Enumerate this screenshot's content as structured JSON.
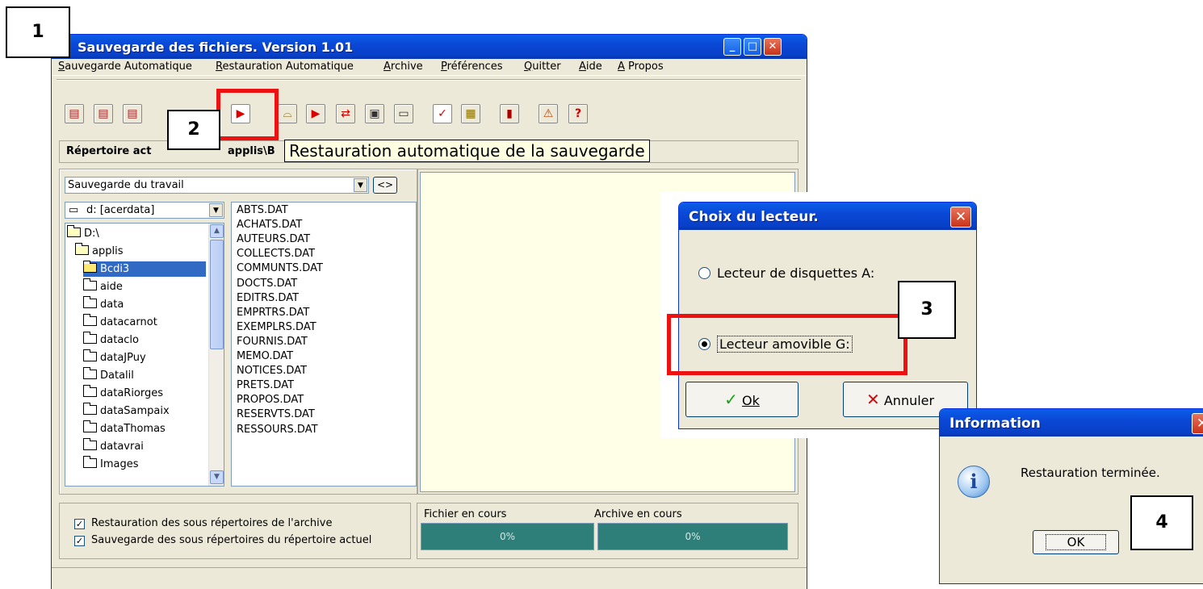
{
  "main_window": {
    "title": "Sauvegarde des fichiers. Version 1.01",
    "title_buttons": {
      "minimize": "_",
      "maximize": "□",
      "close": "✕"
    },
    "menu": [
      "Sauvegarde Automatique",
      "Restauration Automatique",
      "Archive",
      "Préférences",
      "Quitter",
      "Aide",
      "A Propos"
    ],
    "toolbar_icons": [
      "save-all-icon",
      "save-icon",
      "save-alt-icon",
      "restore-auto-icon",
      "open-folder-icon",
      "restore-icon",
      "transfer-icon",
      "copy-icon",
      "folder-icon",
      "check-icon",
      "archive-icon",
      "exit-door-icon",
      "help-book-icon",
      "question-icon"
    ],
    "path_label": "Répertoire act",
    "path_value": "applis\\B",
    "tooltip": "Restauration automatique de la sauvegarde",
    "profile_combo": "Sauvegarde du travail",
    "swap_button": "<>",
    "drive_combo": "d: [acerdata]",
    "tree": [
      {
        "label": "D:\\",
        "indent": 0,
        "open": true
      },
      {
        "label": "applis",
        "indent": 1,
        "open": true
      },
      {
        "label": "Bcdi3",
        "indent": 2,
        "open": true,
        "selected": true
      },
      {
        "label": "aide",
        "indent": 2
      },
      {
        "label": "data",
        "indent": 2
      },
      {
        "label": "datacarnot",
        "indent": 2
      },
      {
        "label": "dataclo",
        "indent": 2
      },
      {
        "label": "dataJPuy",
        "indent": 2
      },
      {
        "label": "Datalil",
        "indent": 2
      },
      {
        "label": "dataRiorges",
        "indent": 2
      },
      {
        "label": "dataSampaix",
        "indent": 2
      },
      {
        "label": "dataThomas",
        "indent": 2
      },
      {
        "label": "datavrai",
        "indent": 2
      },
      {
        "label": "Images",
        "indent": 2
      }
    ],
    "files": [
      "ABTS.DAT",
      "ACHATS.DAT",
      "AUTEURS.DAT",
      "COLLECTS.DAT",
      "COMMUNTS.DAT",
      "DOCTS.DAT",
      "EDITRS.DAT",
      "EMPRTRS.DAT",
      "EXEMPLRS.DAT",
      "FOURNIS.DAT",
      "MEMO.DAT",
      "NOTICES.DAT",
      "PRETS.DAT",
      "PROPOS.DAT",
      "RESERVTS.DAT",
      "RESSOURS.DAT"
    ],
    "options": [
      {
        "label": "Restauration des sous répertoires de l'archive",
        "checked": true
      },
      {
        "label": "Sauvegarde des sous répertoires du répertoire actuel",
        "checked": true
      }
    ],
    "progress": {
      "file_label": "Fichier en cours",
      "file_value": "0%",
      "archive_label": "Archive en cours",
      "archive_value": "0%"
    }
  },
  "drive_dialog": {
    "title": "Choix du lecteur.",
    "options": [
      {
        "label": "Lecteur de disquettes A:",
        "selected": false
      },
      {
        "label": "Lecteur amovible G:",
        "selected": true
      }
    ],
    "ok_label": "Ok",
    "cancel_label": "Annuler",
    "close": "✕"
  },
  "info_dialog": {
    "title": "Information",
    "message": "Restauration terminée.",
    "ok_label": "OK",
    "close": "✕"
  },
  "step_labels": [
    "1",
    "2",
    "3",
    "4"
  ],
  "colors": {
    "highlight_red": "#ee1111",
    "progress_fill": "#2e7f7a",
    "xp_blue": "#0a48d6",
    "panel_yellow": "#ffffe8"
  }
}
